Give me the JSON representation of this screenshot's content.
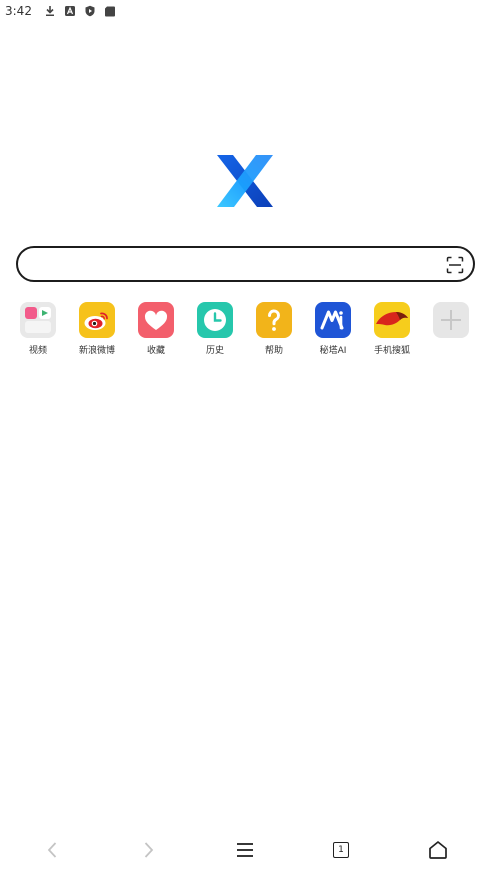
{
  "status_bar": {
    "time": "3:42",
    "icons": [
      "download-icon",
      "a-badge-icon",
      "shield-play-icon",
      "sd-card-icon"
    ]
  },
  "app": {
    "logo": "xbrowser-logo",
    "search": {
      "value": "",
      "placeholder": ""
    }
  },
  "shortcuts": [
    {
      "label": "视频",
      "icon": "video-folder-icon",
      "color": "#e8e8e8"
    },
    {
      "label": "新浪微博",
      "icon": "weibo-icon",
      "color": "#f6c21b"
    },
    {
      "label": "收藏",
      "icon": "heart-icon",
      "color": "#f35f6c"
    },
    {
      "label": "历史",
      "icon": "clock-icon",
      "color": "#26c7ac"
    },
    {
      "label": "帮助",
      "icon": "question-icon",
      "color": "#f2b41a"
    },
    {
      "label": "秘塔AI",
      "icon": "metaso-icon",
      "color": "#1f55d6"
    },
    {
      "label": "手机搜狐",
      "icon": "sohu-icon",
      "color": "#f6cd1c"
    },
    {
      "label": "",
      "icon": "add-icon",
      "color": "#e6e6e6"
    }
  ],
  "navbar": {
    "tab_count": "1",
    "buttons": [
      "back-icon",
      "forward-icon",
      "menu-icon",
      "tabs-icon",
      "home-icon"
    ]
  }
}
